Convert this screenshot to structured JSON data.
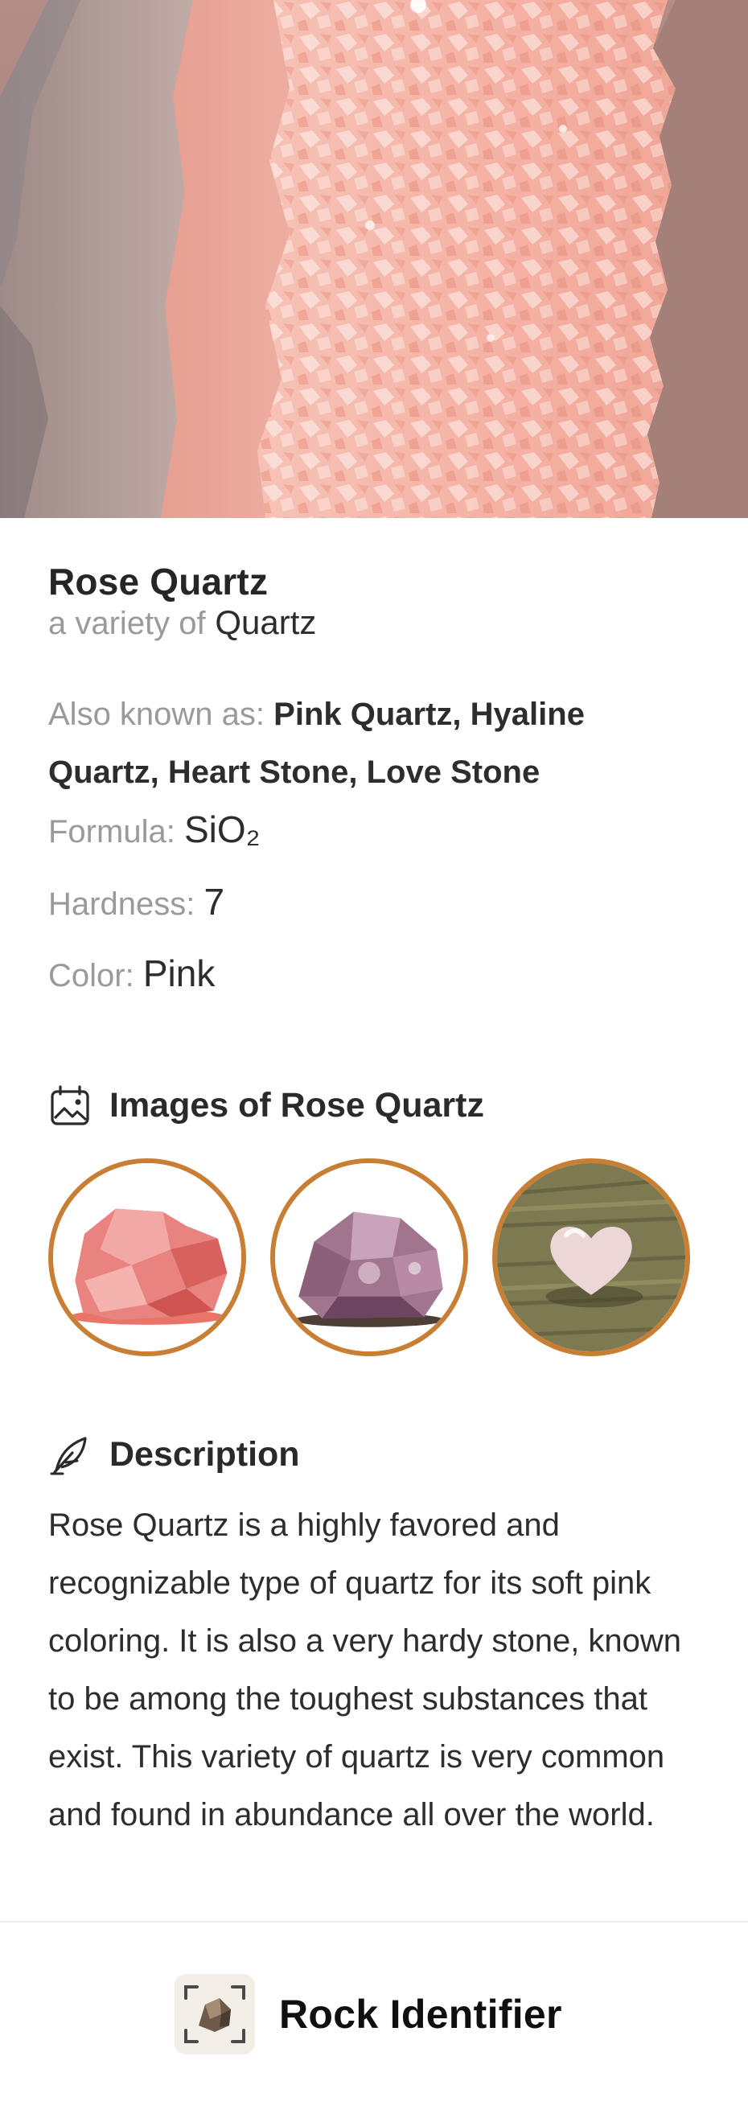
{
  "mineral": {
    "name": "Rose Quartz",
    "variety_prefix": "a variety of",
    "variety_of": "Quartz",
    "aka_label": "Also known as:",
    "aka_values": "Pink Quartz, Hyaline Quartz, Heart Stone, Love Stone",
    "formula_label": "Formula:",
    "formula_value": "SiO₂",
    "hardness_label": "Hardness:",
    "hardness_value": "7",
    "color_label": "Color:",
    "color_value": "Pink"
  },
  "images_section": {
    "title": "Images of Rose Quartz",
    "icon": "gallery-icon"
  },
  "description_section": {
    "title": "Description",
    "icon": "feather-pen-icon",
    "text": "Rose Quartz is a highly favored and recognizable type of quartz for its soft pink coloring. It is also a very hardy stone, known to be among the toughest substances that exist. This variety of quartz is very common and found in abundance all over the world."
  },
  "footer": {
    "app_name": "Rock Identifier",
    "icon": "rock-scan-logo-icon"
  },
  "colors": {
    "thumb_ring": "#c97f33",
    "muted_text": "#9a9a9a"
  }
}
